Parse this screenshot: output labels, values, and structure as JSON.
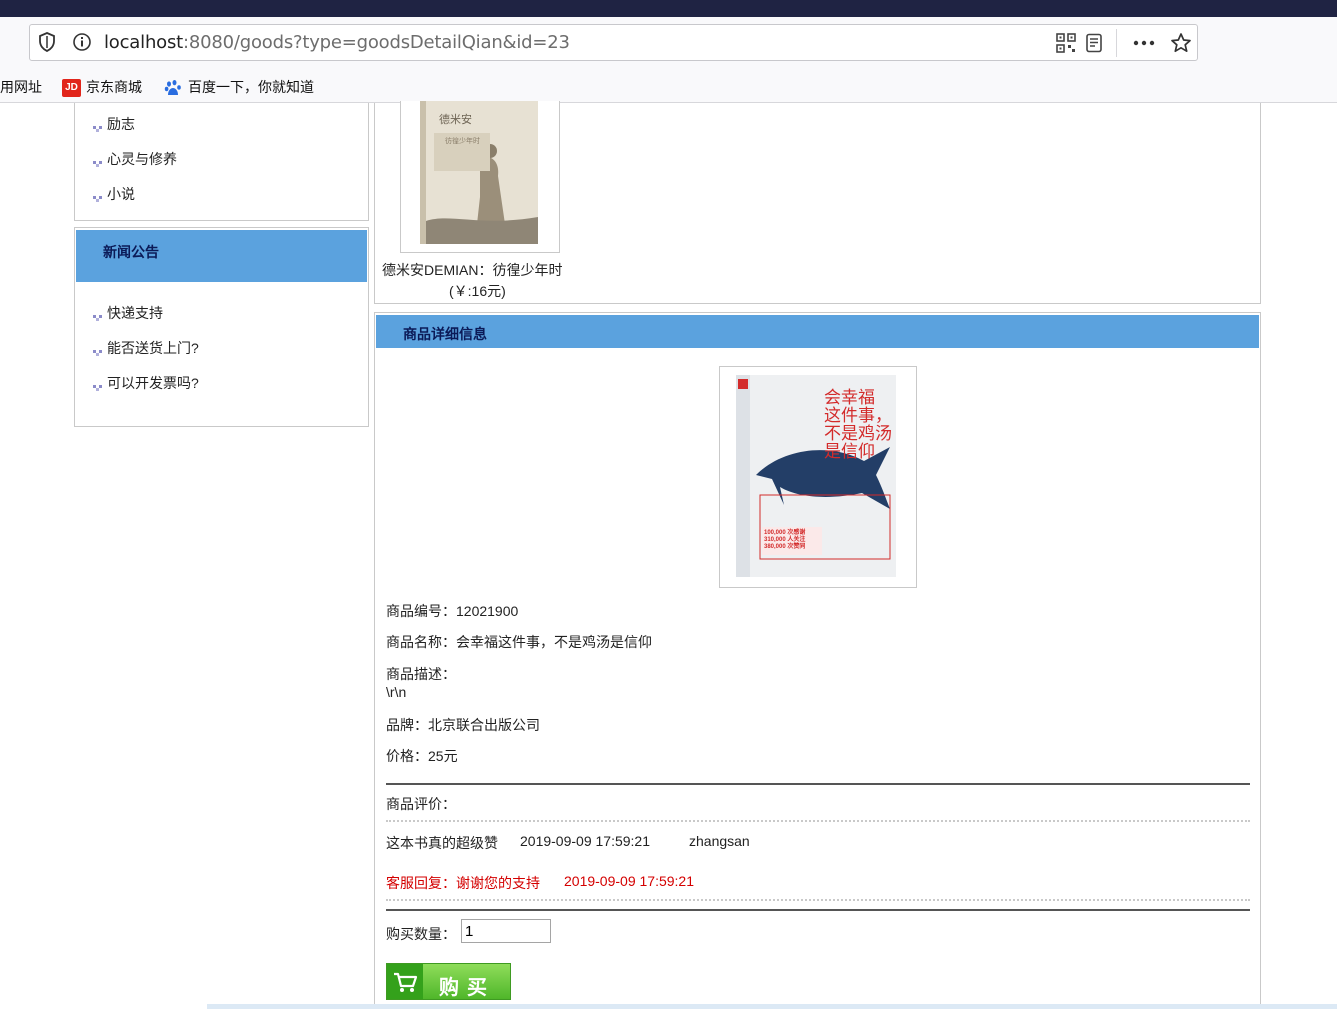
{
  "browser": {
    "url_host": "localhost",
    "url_rest": ":8080/goods?type=goodsDetailQian&id=23",
    "bookmarks": [
      "常用网址",
      "京东商城",
      "百度一下，你就知道"
    ],
    "jd_logo_text": "JD"
  },
  "sidebar": {
    "categories": [
      "励志",
      "心灵与修养",
      "小说"
    ],
    "news_title": "新闻公告",
    "news_items": [
      "快递支持",
      "能否送货上门?",
      "可以开发票吗?"
    ]
  },
  "recommend": {
    "book_title": "德米安DEMIAN：彷徨少年时",
    "book_price": "(￥:16元)",
    "cover_text_1": "德米安",
    "cover_text_2": "彷徨少年时"
  },
  "detail": {
    "panel_title": "商品详细信息",
    "cover": {
      "title_lines": [
        "会幸福",
        "这件事，",
        "不是鸡汤",
        "是信仰"
      ],
      "stats": [
        "100,000 次感谢",
        "310,000 人关注",
        "380,000 次赞同"
      ]
    },
    "id_line": "商品编号：12021900",
    "name_line": "商品名称：会幸福这件事，不是鸡汤是信仰",
    "desc_label": "商品描述：",
    "desc_value": "\\r\\n",
    "brand_line": "品牌：北京联合出版公司",
    "price_line": "价格：25元",
    "review_label": "商品评价：",
    "review_text": "这本书真的超级赞",
    "review_time": "2019-09-09 17:59:21",
    "review_user": "zhangsan",
    "reply_text": "客服回复：谢谢您的支持",
    "reply_time": "2019-09-09 17:59:21",
    "qty_label": "购买数量：",
    "qty_value": "1",
    "buy_label": "购买"
  },
  "colors": {
    "header_blue": "#5ba2de",
    "header_text": "#0b1a57",
    "reply_red": "#d40000",
    "buy_green": "#4fb62a"
  }
}
